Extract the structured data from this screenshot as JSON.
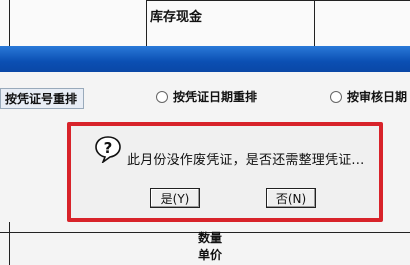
{
  "table_header": {
    "cell_label": "库存现金"
  },
  "options": {
    "sort_by_voucher_no": "按凭证号重排",
    "sort_by_voucher_date": "按凭证日期重排",
    "sort_by_audit_date": "按审核日期"
  },
  "dialog": {
    "message": "此月份没作废凭证，是否还需整理凭证...",
    "yes_label": "是(Y)",
    "no_label": "否(N)",
    "icon": "question-bubble-icon"
  },
  "bottom_fields": {
    "quantity": "数量",
    "unit_price": "单价"
  },
  "colors": {
    "titlebar_blue": "#0b4fb3",
    "highlight_red": "#d8232a"
  }
}
